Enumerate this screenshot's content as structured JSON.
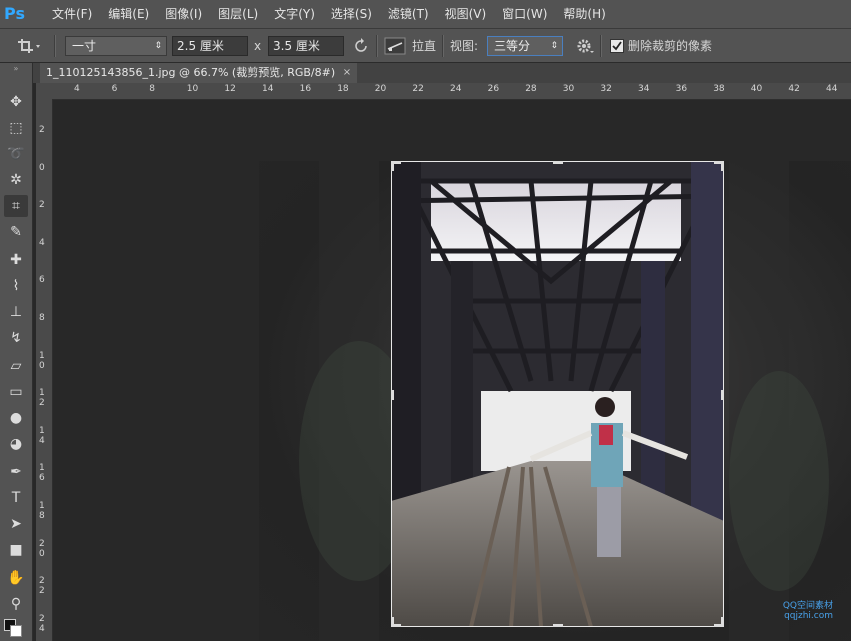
{
  "app": {
    "logo": "Ps"
  },
  "menu": [
    "文件(F)",
    "编辑(E)",
    "图像(I)",
    "图层(L)",
    "文字(Y)",
    "选择(S)",
    "滤镜(T)",
    "视图(V)",
    "窗口(W)",
    "帮助(H)"
  ],
  "options": {
    "preset": "一寸",
    "width": "2.5 厘米",
    "times": "x",
    "height": "3.5 厘米",
    "straighten": "拉直",
    "view_label": "视图:",
    "view_value": "三等分",
    "delete_cropped": "删除裁剪的像素",
    "delete_cropped_checked": true
  },
  "tab": {
    "title": "1_110125143856_1.jpg @ 66.7% (裁剪预览, RGB/8#)",
    "close": "×"
  },
  "ruler_top": [
    "4",
    "6",
    "8",
    "10",
    "12",
    "14",
    "16",
    "18",
    "20",
    "22",
    "24",
    "26",
    "28",
    "30",
    "32",
    "34",
    "36",
    "38",
    "40",
    "42",
    "44"
  ],
  "ruler_left": [
    "2",
    "0",
    "2",
    "4",
    "6",
    "8",
    "1\n0",
    "1\n2",
    "1\n4",
    "1\n6",
    "1\n8",
    "2\n0",
    "2\n2",
    "2\n4"
  ],
  "tools": [
    "move-icon",
    "marquee-icon",
    "lasso-icon",
    "magic-wand-icon",
    "crop-icon",
    "eyedropper-icon",
    "healing-icon",
    "brush-icon",
    "stamp-icon",
    "history-brush-icon",
    "eraser-icon",
    "gradient-icon",
    "blur-icon",
    "dodge-icon",
    "pen-icon",
    "type-icon",
    "path-select-icon",
    "rectangle-icon",
    "hand-icon",
    "zoom-icon"
  ],
  "watermark": [
    "QQ空间素材",
    "qqjzhi.com"
  ]
}
